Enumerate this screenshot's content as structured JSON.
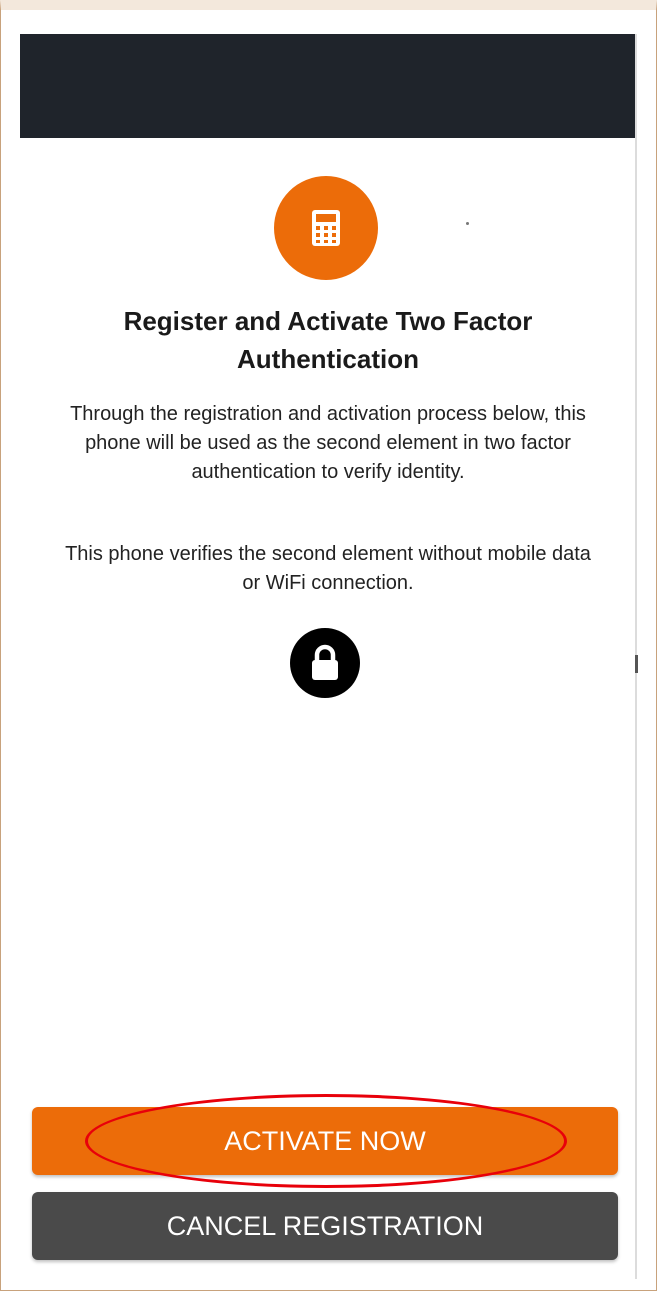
{
  "colors": {
    "app_bar": "#1f242b",
    "accent": "#ec6c09",
    "cancel_button": "#4a4a4a",
    "highlight": "#e8000a"
  },
  "icons": {
    "hero": "calculator-icon",
    "secure": "lock-icon"
  },
  "main": {
    "title": "Register and Activate Two Factor Authentication",
    "paragraph_1": "Through the registration and activation process below, this phone will be used as the second element in two factor authentication to verify identity.",
    "paragraph_2": "This phone verifies the second element without mobile data or WiFi connection."
  },
  "actions": {
    "activate_label": "ACTIVATE NOW",
    "cancel_label": "CANCEL REGISTRATION"
  }
}
